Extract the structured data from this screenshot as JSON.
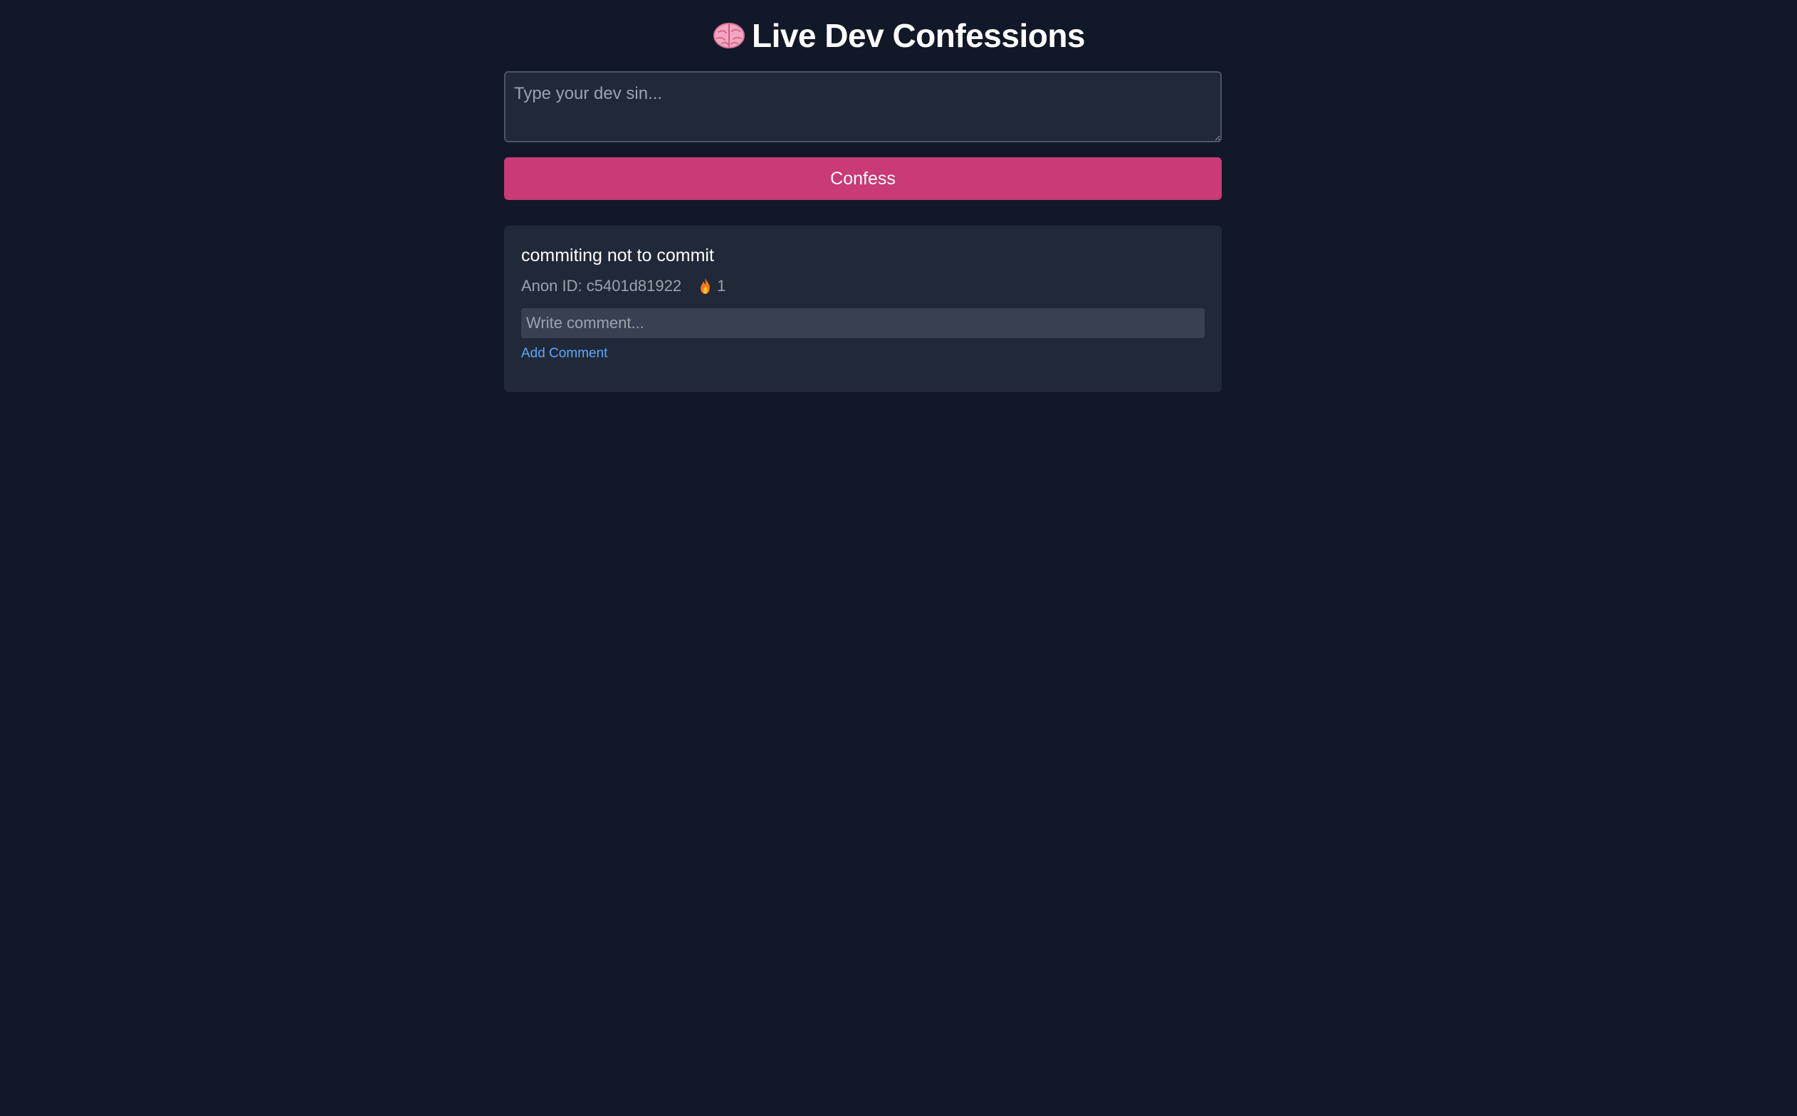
{
  "header": {
    "icon": "brain-icon",
    "title": "Live Dev Confessions"
  },
  "composer": {
    "placeholder": "Type your dev sin...",
    "value": "",
    "submit_label": "Confess"
  },
  "confessions": [
    {
      "text": "commiting not to commit",
      "anon_label": "Anon ID: c5401d81922",
      "reaction_icon": "fire-icon",
      "reaction_count": "1",
      "comment_placeholder": "Write comment...",
      "comment_value": "",
      "add_comment_label": "Add Comment"
    }
  ],
  "colors": {
    "background": "#111827",
    "card": "#1f2937",
    "accent": "#c93a76",
    "link": "#60a5fa",
    "muted_text": "#9ca3af"
  }
}
